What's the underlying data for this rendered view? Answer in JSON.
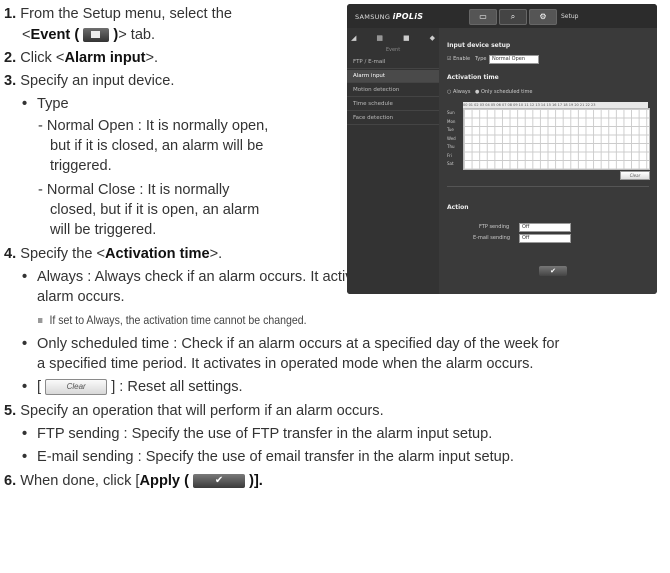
{
  "steps": {
    "s1": {
      "num": "1.",
      "pre": "From the Setup menu, select the",
      "lt": "<",
      "bold": "Event (",
      "bold_close": ")",
      "post": "> tab."
    },
    "s2": {
      "num": "2.",
      "pre": "Click <",
      "bold": "Alarm input",
      "post": ">."
    },
    "s3": {
      "num": "3.",
      "text": "Specify an input device.",
      "type_label": "Type",
      "no_lines": [
        "- Normal Open : It is normally open,",
        "but if it is closed, an alarm will be",
        "triggered."
      ],
      "nc_lines": [
        "- Normal Close : It is normally",
        "closed, but if it is open, an alarm",
        "will be triggered."
      ]
    },
    "s4": {
      "num": "4.",
      "pre": "Specify the <",
      "bold": "Activation time",
      "post": ">.",
      "always_lines": [
        "Always : Always check if an alarm occurs. It activates in operated mode when the",
        "alarm occurs."
      ],
      "note": "If set to Always, the activation time cannot be changed.",
      "sched_lines": [
        "Only scheduled time : Check if an alarm occurs at a specified day of the week for",
        "a specified time period. It activates in operated mode when the alarm occurs."
      ],
      "clear_pre": "[",
      "clear_btn": "Clear",
      "clear_post": "] : Reset all settings."
    },
    "s5": {
      "num": "5.",
      "text": "Specify an operation that will perform if an alarm occurs.",
      "ftp": "FTP sending : Specify the use of FTP transfer in the alarm input setup.",
      "email": "E-mail sending : Specify the use of email transfer in the alarm input setup."
    },
    "s6": {
      "num": "6.",
      "pre": "When done, click [",
      "bold": "Apply (",
      "apply_glyph": "✔",
      "post": ")]."
    }
  },
  "screenshot": {
    "logo_brand": "SAMSUNG",
    "logo_product": "iPOLiS",
    "header_tab": "Setup",
    "sidebar_sub": "Event",
    "sidebar_items": [
      "FTP / E-mail",
      "Alarm input",
      "Motion detection",
      "Time schedule",
      "Face detection"
    ],
    "input_section": "Input device setup",
    "enable_label": "Enable",
    "type_label": "Type",
    "type_value": "Normal Open",
    "activation_section": "Activation time",
    "radio_always": "Always",
    "radio_sched": "Only scheduled time",
    "hours": "00 01 02 03 04 05 06 07 08 09 10 11 12 13 14 15 16 17 18 19 20 21 22 23",
    "days": [
      "Sun",
      "Mon",
      "Tue",
      "Wed",
      "Thu",
      "Fri",
      "Sat"
    ],
    "clear": "Clear",
    "action_section": "Action",
    "ftp_label": "FTP sending",
    "ftp_value": "Off",
    "email_label": "E-mail sending",
    "email_value": "Off",
    "apply_glyph": "✔"
  }
}
